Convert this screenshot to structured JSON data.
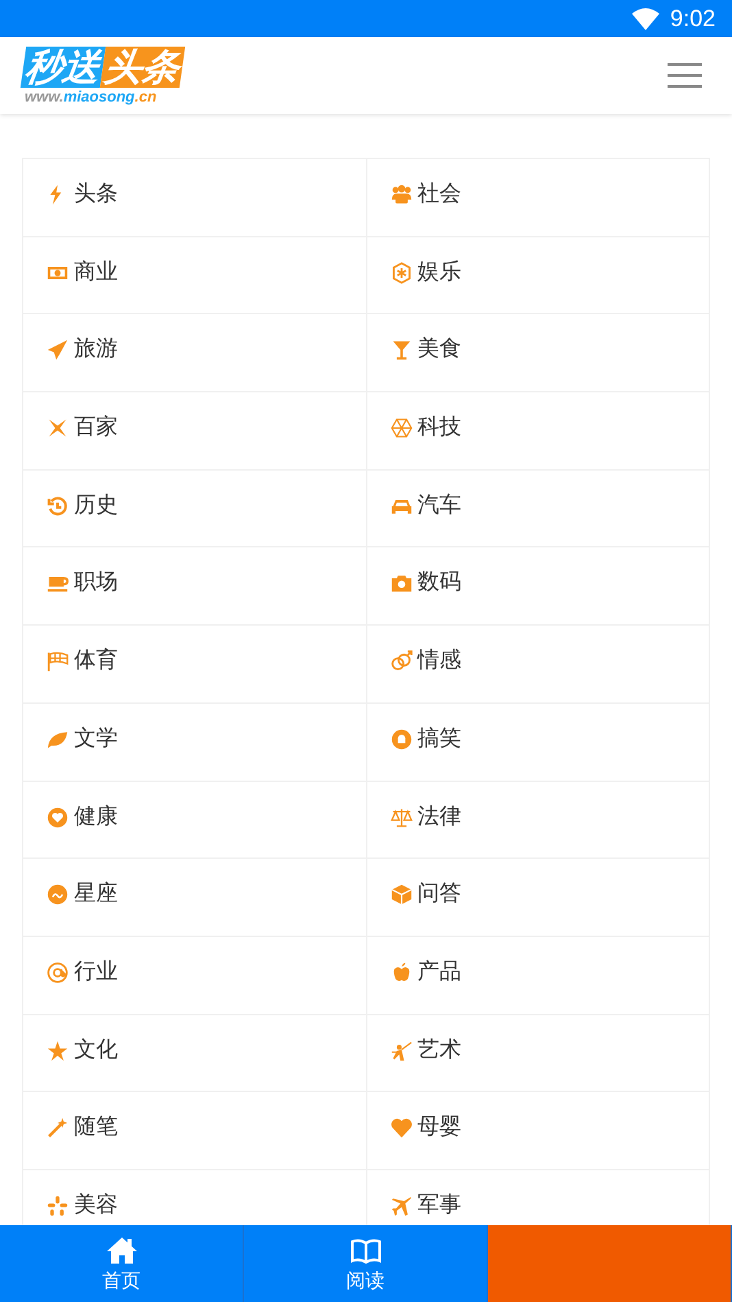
{
  "status_bar": {
    "time": "9:02"
  },
  "header": {
    "logo": {
      "title_part1": "秒送",
      "title_part2": "头条",
      "url_part1": "www.",
      "url_part2": "miaosong",
      "url_part3": ".cn"
    }
  },
  "categories": [
    {
      "label": "头条"
    },
    {
      "label": "社会"
    },
    {
      "label": "商业"
    },
    {
      "label": "娱乐"
    },
    {
      "label": "旅游"
    },
    {
      "label": "美食"
    },
    {
      "label": "百家"
    },
    {
      "label": "科技"
    },
    {
      "label": "历史"
    },
    {
      "label": "汽车"
    },
    {
      "label": "职场"
    },
    {
      "label": "数码"
    },
    {
      "label": "体育"
    },
    {
      "label": "情感"
    },
    {
      "label": "文学"
    },
    {
      "label": "搞笑"
    },
    {
      "label": "健康"
    },
    {
      "label": "法律"
    },
    {
      "label": "星座"
    },
    {
      "label": "问答"
    },
    {
      "label": "行业"
    },
    {
      "label": "产品"
    },
    {
      "label": "文化"
    },
    {
      "label": "艺术"
    },
    {
      "label": "随笔"
    },
    {
      "label": "母婴"
    },
    {
      "label": "美容"
    },
    {
      "label": "军事"
    }
  ],
  "bottom_nav": [
    {
      "label": "首页",
      "selected": false
    },
    {
      "label": "阅读",
      "selected": false
    },
    {
      "selected": true
    }
  ]
}
